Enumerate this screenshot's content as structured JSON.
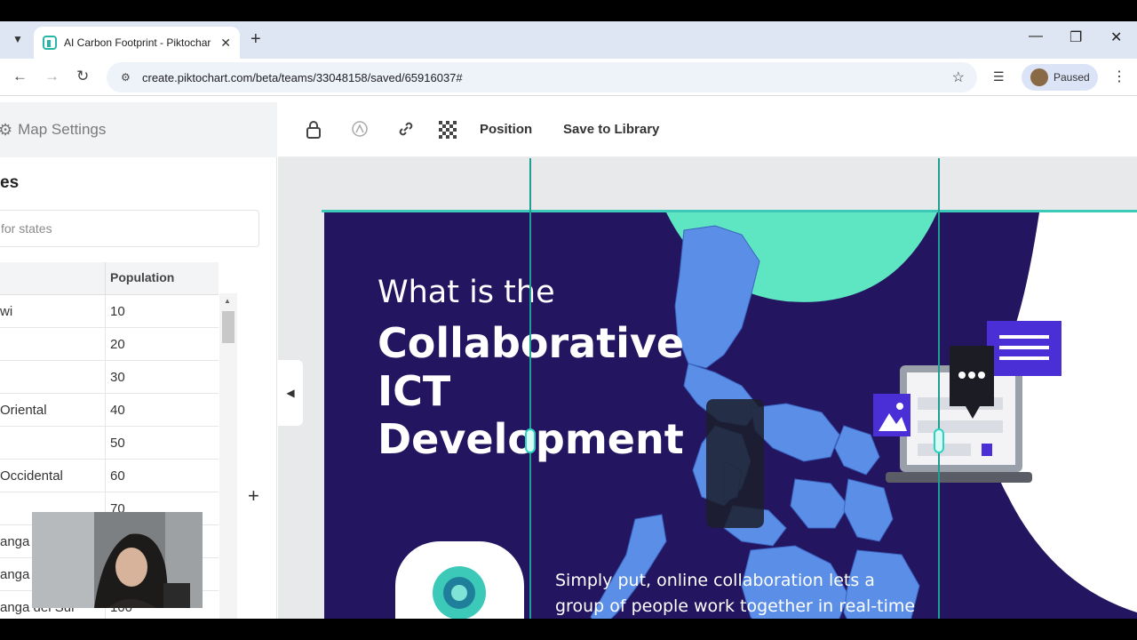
{
  "browser": {
    "tab_title": "AI Carbon Footprint - Piktochar",
    "url": "create.piktochart.com/beta/teams/33048158/saved/65916037#",
    "profile_label": "Paused"
  },
  "panel": {
    "title": "Map Settings",
    "states_heading": "es",
    "search_placeholder": "for states",
    "column_population": "Population",
    "rows": [
      {
        "name": "wi",
        "population": "10"
      },
      {
        "name": "",
        "population": "20"
      },
      {
        "name": "",
        "population": "30"
      },
      {
        "name": "Oriental",
        "population": "40"
      },
      {
        "name": "",
        "population": "50"
      },
      {
        "name": "Occidental",
        "population": "60"
      },
      {
        "name": "",
        "population": "70"
      },
      {
        "name": "anga",
        "population": ""
      },
      {
        "name": "anga",
        "population": ""
      },
      {
        "name": "anga del Sur",
        "population": "100"
      }
    ]
  },
  "toolbar": {
    "position_label": "Position",
    "save_label": "Save to Library"
  },
  "slide": {
    "line1": "What is the",
    "line2": "Collaborative",
    "line3": "ICT",
    "line4": "Development",
    "body": "Simply put, online collaboration lets a group of people work together in real-time over the internet",
    "colors": {
      "background": "#241560",
      "accent_teal": "#5ee6c2",
      "map_blue": "#5b8ee6",
      "purple": "#4a2fd6"
    }
  }
}
